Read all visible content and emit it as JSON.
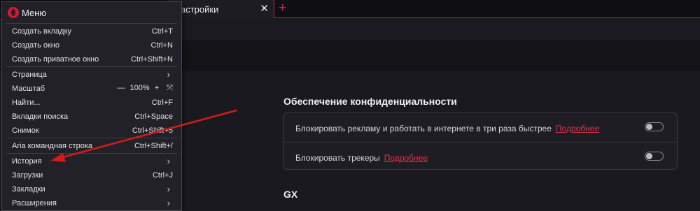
{
  "tab": {
    "title": "астройки",
    "close_glyph": "✕",
    "new_glyph": "+"
  },
  "menu": {
    "title": "Меню",
    "groups": [
      [
        {
          "label": "Создать вкладку",
          "shortcut": "Ctrl+T"
        },
        {
          "label": "Создать окно",
          "shortcut": "Ctrl+N"
        },
        {
          "label": "Создать приватное окно",
          "shortcut": "Ctrl+Shift+N"
        }
      ],
      [
        {
          "label": "Страница",
          "arrow": "›"
        },
        {
          "label": "Масштаб",
          "zoom": {
            "minus": "—",
            "value": "100%",
            "plus": "+",
            "fullscreen": "⤧"
          }
        },
        {
          "label": "Найти...",
          "shortcut": "Ctrl+F"
        },
        {
          "label": "Вкладки поиска",
          "shortcut": "Ctrl+Space"
        },
        {
          "label": "Снимок",
          "shortcut": "Ctrl+Shift+5"
        }
      ],
      [
        {
          "label": "Aria командная строка",
          "shortcut": "Ctrl+Shift+/"
        }
      ],
      [
        {
          "label": "История",
          "arrow": "›"
        },
        {
          "label": "Загрузки",
          "shortcut": "Ctrl+J"
        },
        {
          "label": "Закладки",
          "arrow": "›"
        },
        {
          "label": "Расширения",
          "arrow": "›"
        }
      ]
    ]
  },
  "settings": {
    "privacy_title": "Обеспечение конфиденциальности",
    "rows": [
      {
        "text": "Блокировать рекламу и работать в интернете в три раза быстрее",
        "link": "Подробнее",
        "enabled": false
      },
      {
        "text": "Блокировать трекеры",
        "link": "Подробнее",
        "enabled": false
      }
    ],
    "gx_title": "GX"
  },
  "colors": {
    "accent": "#d8243f",
    "menu_bg": "#222127",
    "page_bg": "#1a1920",
    "arrow": "#d41a1a"
  }
}
